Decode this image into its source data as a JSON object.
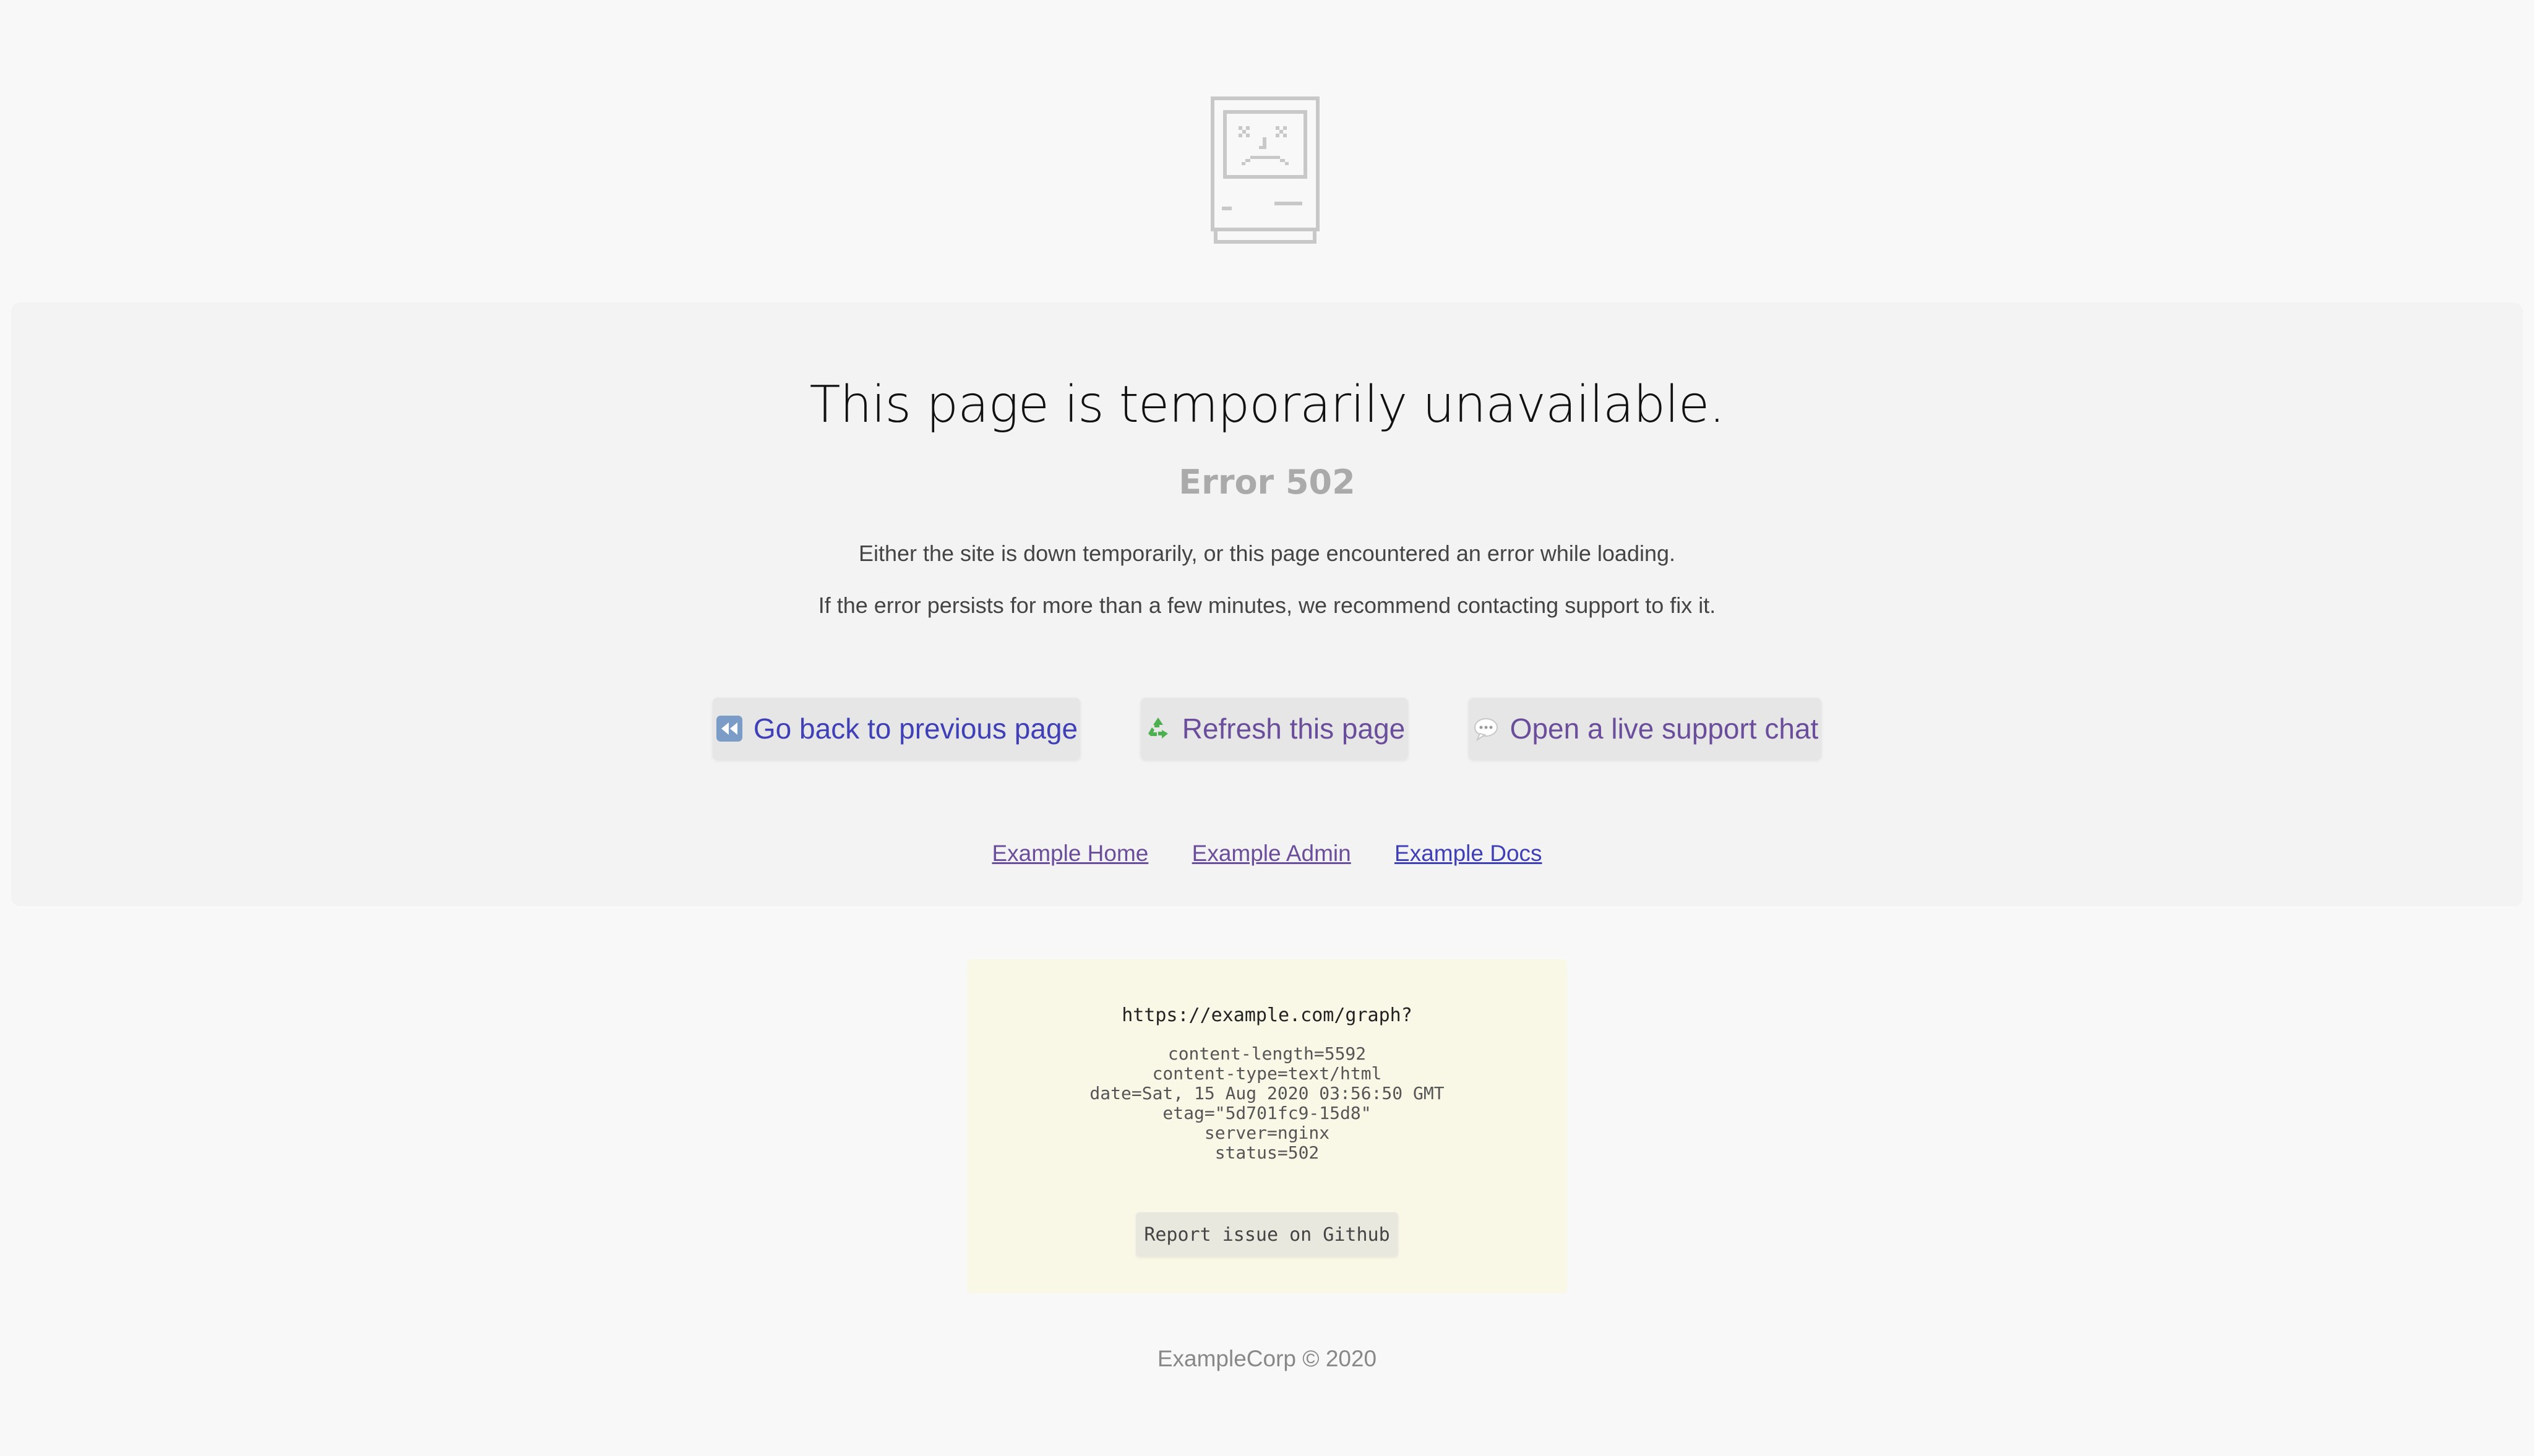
{
  "page": {
    "title": "This page is temporarily unavailable.",
    "subtitle": "Error 502",
    "description_line1": "Either the site is down temporarily, or this page encountered an error while loading.",
    "description_line2": "If the error persists for more than a few minutes, we recommend contacting support to fix it."
  },
  "actions": {
    "back_label": "Go back to previous page",
    "refresh_label": "Refresh this page",
    "chat_label": "Open a live support chat"
  },
  "links": [
    {
      "label": "Example Home"
    },
    {
      "label": "Example Admin"
    },
    {
      "label": "Example Docs"
    }
  ],
  "request_info": {
    "url": "https://example.com/graph?",
    "headers": [
      "content-length=5592",
      "content-type=text/html",
      "date=Sat, 15 Aug 2020 03:56:50 GMT",
      "etag=\"5d701fc9-15d8\"",
      "server=nginx",
      "status=502"
    ],
    "report_button_label": "Report issue on Github"
  },
  "footer": {
    "text": "ExampleCorp © 2020"
  },
  "icons": {
    "sad_mac": "sad-computer-icon",
    "back": "rewind-icon",
    "refresh": "recycle-icon",
    "chat": "speech-bubble-icon"
  },
  "colors": {
    "link_visited": "#6b4e9b",
    "link": "#3f3fb8",
    "info_box_bg": "#f9f7e6",
    "recycle_green": "#4caf50"
  }
}
